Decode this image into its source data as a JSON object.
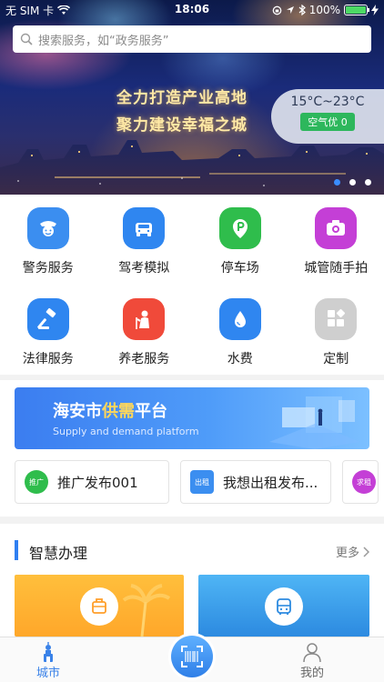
{
  "status_bar": {
    "carrier": "无 SIM 卡",
    "time": "18:06",
    "battery": "100%"
  },
  "search": {
    "placeholder": "搜索服务，如“政务服务”"
  },
  "hero": {
    "slogan_line1": "全力打造产业高地",
    "slogan_line2": "聚力建设幸福之城",
    "weather_temp": "15°C~23°C",
    "air_quality": "空气优 0",
    "carousel_active_index": 0,
    "carousel_count": 3
  },
  "services": [
    {
      "label": "警务服务",
      "icon": "police-icon",
      "color": "#3b8ef0"
    },
    {
      "label": "驾考模拟",
      "icon": "car-icon",
      "color": "#2f86f0"
    },
    {
      "label": "停车场",
      "icon": "parking-icon",
      "color": "#2fbd4c"
    },
    {
      "label": "城管随手拍",
      "icon": "camera-icon",
      "color": "#c43fd6"
    },
    {
      "label": "法律服务",
      "icon": "gavel-icon",
      "color": "#2f86f0"
    },
    {
      "label": "养老服务",
      "icon": "elderly-care-icon",
      "color": "#f04a3a"
    },
    {
      "label": "水费",
      "icon": "water-drop-icon",
      "color": "#2f86f0"
    },
    {
      "label": "定制",
      "icon": "customize-icon",
      "color": "#cfcfcf"
    }
  ],
  "supply_banner": {
    "title_prefix": "海安市",
    "title_highlight": "供需",
    "title_suffix": "平台",
    "subtitle": "Supply and demand platform"
  },
  "ads": [
    {
      "badge": "推广",
      "text": "推广发布001",
      "color": "#2fbd4c"
    },
    {
      "badge": "出租",
      "text": "我想出租发布...",
      "color": "#3b8ef0"
    },
    {
      "badge": "求租",
      "text": "",
      "color": "#c43fd6"
    }
  ],
  "smart": {
    "title": "智慧办理",
    "more": "更多"
  },
  "tabbar": {
    "city": "城市",
    "me": "我的"
  }
}
